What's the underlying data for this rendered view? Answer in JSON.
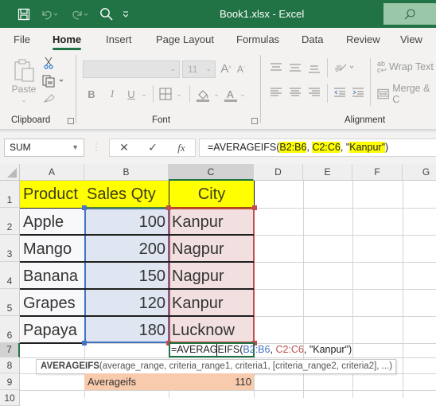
{
  "window": {
    "title": "Book1.xlsx  -  Excel",
    "quick_access": [
      "save-icon",
      "undo-icon",
      "redo-icon",
      "search-icon",
      "customize-qat-icon"
    ],
    "accent_color": "#217346"
  },
  "tabs": [
    {
      "label": "File",
      "active": false
    },
    {
      "label": "Home",
      "active": true
    },
    {
      "label": "Insert",
      "active": false
    },
    {
      "label": "Page Layout",
      "active": false
    },
    {
      "label": "Formulas",
      "active": false
    },
    {
      "label": "Data",
      "active": false
    },
    {
      "label": "Review",
      "active": false
    },
    {
      "label": "View",
      "active": false
    }
  ],
  "ribbon": {
    "clipboard": {
      "label": "Clipboard",
      "paste_label": "Paste"
    },
    "font": {
      "label": "Font",
      "font_name": "",
      "font_size": "11",
      "bold": "B",
      "italic": "I",
      "underline": "U"
    },
    "alignment": {
      "label": "Alignment",
      "wrap_text": "Wrap Text",
      "merge": "Merge & C"
    }
  },
  "formula_bar": {
    "name_box": "SUM",
    "cancel_symbol": "✕",
    "enter_symbol": "✓",
    "fx_symbol": "fx",
    "formula_parts": [
      {
        "text": "=AVERAGEIFS(",
        "highlight": false
      },
      {
        "text": "B2:B6",
        "highlight": true
      },
      {
        "text": ", ",
        "highlight": false
      },
      {
        "text": "C2:C6",
        "highlight": true
      },
      {
        "text": ", \"",
        "highlight": false
      },
      {
        "text": "Kanpur\"",
        "highlight": true
      },
      {
        "text": ")",
        "highlight": false
      }
    ]
  },
  "sheet": {
    "columns": [
      "A",
      "B",
      "C",
      "D",
      "E",
      "F",
      "G"
    ],
    "rows": [
      "1",
      "2",
      "3",
      "4",
      "5",
      "6",
      "7",
      "8",
      "9",
      "10"
    ],
    "headers": [
      "Product",
      "Sales Qty",
      "City"
    ],
    "data": [
      {
        "product": "Apple",
        "qty": "100",
        "city": "Kanpur"
      },
      {
        "product": "Mango",
        "qty": "200",
        "city": "Nagpur"
      },
      {
        "product": "Banana",
        "qty": "150",
        "city": "Nagpur"
      },
      {
        "product": "Grapes",
        "qty": "120",
        "city": "Kanpur"
      },
      {
        "product": "Papaya",
        "qty": "180",
        "city": "Lucknow"
      }
    ],
    "editing_cell": {
      "ref": "C7",
      "parts": [
        {
          "text": "=AVERAGEIFS(",
          "color": "#222222"
        },
        {
          "text": "B2:B6",
          "color": "#4472c4"
        },
        {
          "text": ", ",
          "color": "#222222"
        },
        {
          "text": "C2:C6",
          "color": "#c0504d"
        },
        {
          "text": ", \"Kanpur\")",
          "color": "#222222"
        }
      ]
    },
    "tooltip": {
      "function_name": "AVERAGEIFS",
      "args": "(average_range, criteria_range1, criteria1, [criteria_range2, criteria2], ...)"
    },
    "result_row": {
      "label": "Averageifs",
      "value": "110",
      "fill_color": "#f8cbad"
    },
    "header_fill": "#ffff00",
    "range_colors": {
      "B": "#4472c4",
      "C": "#c0504d"
    }
  }
}
